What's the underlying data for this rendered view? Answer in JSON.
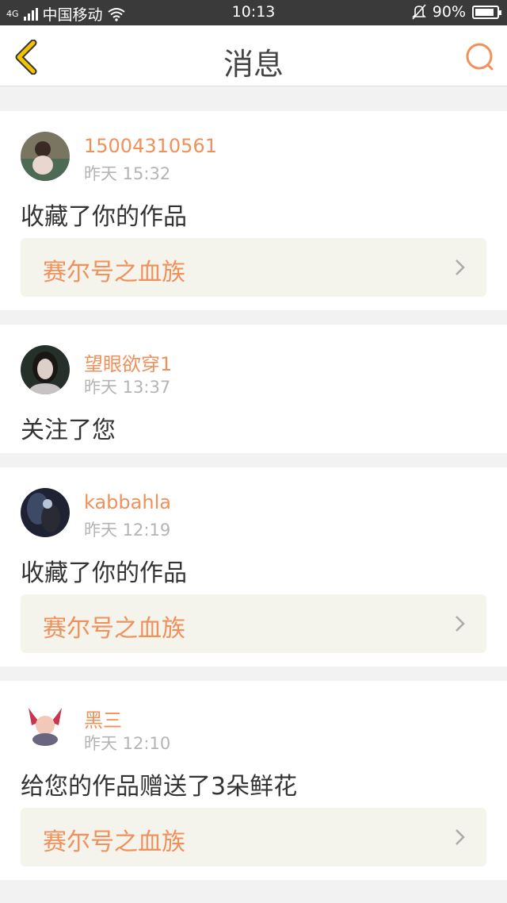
{
  "status_bar": {
    "network": "4G",
    "carrier": "中国移动",
    "time": "10:13",
    "battery": "90%",
    "battery_level": 0.9,
    "icons": [
      "signal-icon",
      "wifi-icon",
      "alarm-off-icon",
      "battery-icon"
    ]
  },
  "header": {
    "title": "消息",
    "back_icon": "chevron-left-icon",
    "search_icon": "search-icon"
  },
  "messages": [
    {
      "user": "15004310561",
      "time": "昨天 15:32",
      "action": "收藏了你的作品",
      "work": "赛尔号之血族"
    },
    {
      "user": "望眼欲穿1",
      "time": "昨天 13:37",
      "action": "关注了您"
    },
    {
      "user": "kabbahla",
      "time": "昨天 12:19",
      "action": "收藏了你的作品",
      "work": "赛尔号之血族"
    },
    {
      "user": "黑三",
      "time": "昨天 12:10",
      "action": "给您的作品赠送了3朵鲜花",
      "work": "赛尔号之血族"
    }
  ],
  "colors": {
    "accent": "#f0905a",
    "back_icon": "#f2c400",
    "status_bar": "#3a3a3a",
    "background": "#f2f2f2",
    "link_box": "#f4f3ec"
  }
}
